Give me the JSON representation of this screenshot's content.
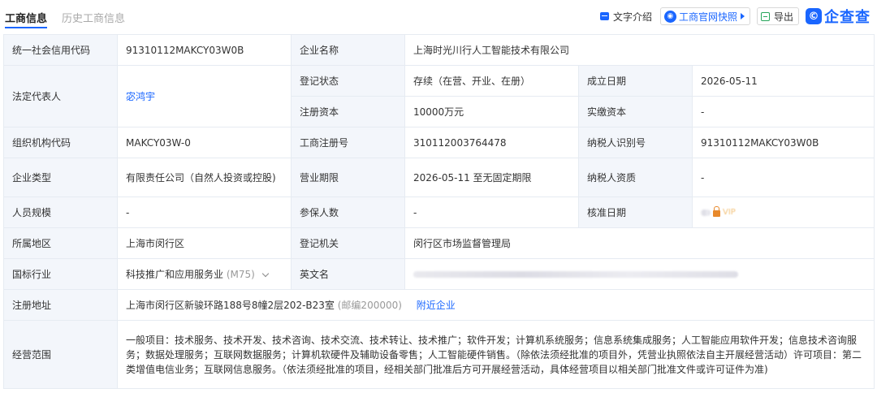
{
  "tabs": {
    "active": "工商信息",
    "history": "历史工商信息"
  },
  "toolbar": {
    "text_intro": "文字介绍",
    "snapshot": "工商官网快照",
    "export": "导出",
    "logo_text": "企查查"
  },
  "rows": {
    "credit_code": {
      "label": "统一社会信用代码",
      "value": "91310112MAKCY03W0B"
    },
    "company_name": {
      "label": "企业名称",
      "value": "上海时光川行人工智能技术有限公司"
    },
    "legal_rep": {
      "label": "法定代表人",
      "value": "宓鸿宇"
    },
    "reg_status": {
      "label": "登记状态",
      "value": "存续（在营、开业、在册）"
    },
    "est_date": {
      "label": "成立日期",
      "value": "2026-05-11"
    },
    "reg_capital": {
      "label": "注册资本",
      "value": "10000万元"
    },
    "paid_capital": {
      "label": "实缴资本",
      "value": "-"
    },
    "org_code": {
      "label": "组织机构代码",
      "value": "MAKCY03W-0"
    },
    "reg_no": {
      "label": "工商注册号",
      "value": "310112003764478"
    },
    "taxpayer_id": {
      "label": "纳税人识别号",
      "value": "91310112MAKCY03W0B"
    },
    "company_type": {
      "label": "企业类型",
      "value": "有限责任公司（自然人投资或控股)"
    },
    "business_term": {
      "label": "营业期限",
      "value": "2026-05-11 至无固定期限"
    },
    "taxpayer_qual": {
      "label": "纳税人资质",
      "value": "-"
    },
    "staff_size": {
      "label": "人员规模",
      "value": "-"
    },
    "insured": {
      "label": "参保人数",
      "value": "-"
    },
    "approval_date": {
      "label": "核准日期",
      "vip": "VIP"
    },
    "region": {
      "label": "所属地区",
      "value": "上海市闵行区"
    },
    "reg_authority": {
      "label": "登记机关",
      "value": "闵行区市场监督管理局"
    },
    "industry": {
      "label": "国标行业",
      "value": "科技推广和应用服务业",
      "code": "(M75)"
    },
    "english_name": {
      "label": "英文名"
    },
    "address": {
      "label": "注册地址",
      "value": "上海市闵行区新骏环路188号8幢2层202-B23室",
      "postcode": "(邮编200000)",
      "nearby": "附近企业"
    },
    "scope": {
      "label": "经营范围",
      "value": "一般项目：技术服务、技术开发、技术咨询、技术交流、技术转让、技术推广；软件开发；计算机系统服务；信息系统集成服务；人工智能应用软件开发；信息技术咨询服务；数据处理服务；互联网数据服务；计算机软硬件及辅助设备零售；人工智能硬件销售。（除依法须经批准的项目外，凭营业执照依法自主开展经营活动）许可项目：第二类增值电信业务；互联网信息服务。（依法须经批准的项目，经相关部门批准后方可开展经营活动，具体经营项目以相关部门批准文件或许可证件为准)"
    }
  },
  "colors": {
    "accent": "#1a66ff",
    "label_bg": "#f3f6fb",
    "border": "#e6ebf2"
  }
}
